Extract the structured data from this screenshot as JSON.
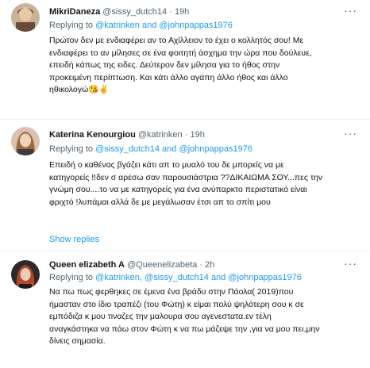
{
  "tweets": [
    {
      "display_name": "MikriDaneza",
      "handle": "@sissy_dutch14",
      "time": "19h",
      "replying_prefix": "Replying to",
      "replying_to": "@katrinken and @johnpappas1976",
      "lines": [
        "Πρώτον δεν με ενδιαφέρει αν το Αχίλλειον το έχει ο κολλητός σου! Με",
        "ενδιαφέρει το αν μίλησες σε ένα φοιτητή άσχημα την ώρα που δούλευε,",
        "επειδή κάπως της ειδες. Δεύτερον δεν μίλησα για το ήθος στην",
        "προκειμένη περίπτωση. Και κάτι άλλο αγάπη άλλο ήθος και άλλο",
        "ηθικολογώ"
      ],
      "emoji": "😘✌"
    },
    {
      "display_name": "Katerina Kenourgiou",
      "handle": "@katrinken",
      "time": "19h",
      "replying_prefix": "Replying to",
      "replying_to": "@sissy_dutch14 and @johnpappas1976",
      "lines": [
        "Επειδή ο καθένας βγάζει κάτι απ το μυαλό του δε μπορείς να με",
        "κατηγορείς !!δεν σ αρέσω σαν παρουσιάστρια ??ΔΙΚΑΙΩΜΑ ΣΟΥ...πες την",
        "γνώμη σου....το να με κατηγορείς για ένα ανύπαρκτο περιστατικό είναι",
        "φριχτό !λυπάμαι αλλά δε με μεγάλωσαν έτσι απ το σπίτι μου"
      ]
    },
    {
      "display_name": "Queen elizabeth A",
      "handle": "@Queenelizabeta",
      "time": "2h",
      "replying_prefix": "Replying to",
      "replying_to": "@katrinken, @sissy_dutch14 and @johnpappas1976",
      "lines": [
        "Να πω πως φερθηκες σε έμενα ένα βράδυ στην Πάολα( 2019)που",
        "ήμασταν στο ίδιο τραπέζι (του Φώτη) κ είμαι πολύ ψηλότερη σου κ σε",
        "εμπόδιζα κ μου τιναζες την μαλουρα σου αγενεστατα.εν τέλη",
        "αναγκάστηκα να πάω στον Φώτη κ να πω μάζεψε την ,για να μου πει,μην",
        "δίνεις σημασία."
      ]
    }
  ],
  "show_replies": "Show replies",
  "more_glyph": "···",
  "colors": {
    "accent": "#1d9bf0",
    "secondary_text": "#536471",
    "divider": "#eff3f4"
  },
  "icons": [
    "more-icon",
    "kiss-emoji-icon",
    "victory-hand-emoji-icon"
  ]
}
